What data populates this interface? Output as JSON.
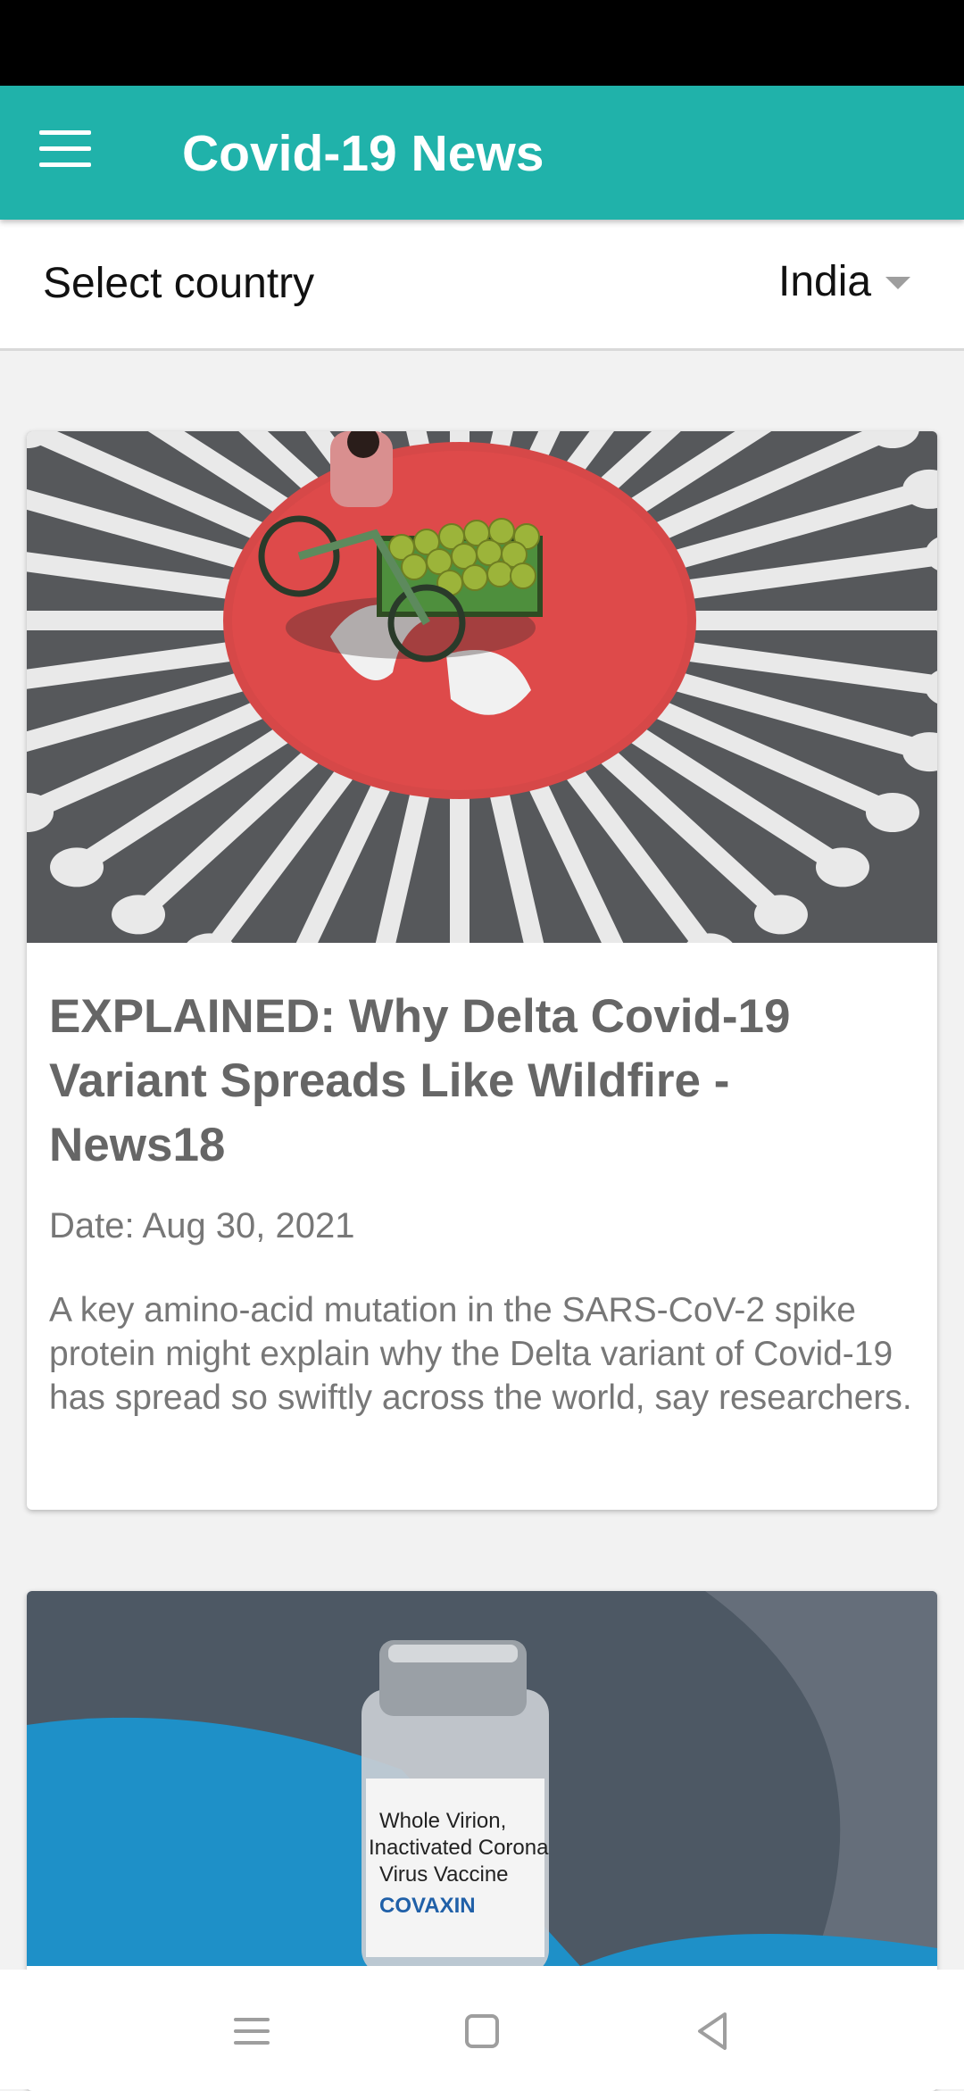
{
  "app_bar": {
    "title": "Covid-19 News",
    "menu_icon": "hamburger-menu-icon",
    "background": "#20b2aa"
  },
  "country_selector": {
    "label": "Select country",
    "selected": "India"
  },
  "articles": [
    {
      "image": "covid-virus-road-painting-with-coconut-cart",
      "title": "EXPLAINED: Why Delta Covid-19 Variant Spreads Like Wildfire - News18",
      "date": "Date: Aug 30, 2021",
      "description": "A key amino-acid mutation in the SARS-CoV-2 spike protein might explain why the Delta variant of Covid-19 has spread so swiftly across the world, say researchers."
    },
    {
      "image": "covaxin-vaccine-vial",
      "vial_lines": [
        "Whole Virion,",
        "Inactivated Corona",
        "Virus Vaccine",
        "COVAXIN"
      ]
    }
  ],
  "nav_bar": {
    "icons": [
      "recents-icon",
      "home-icon",
      "back-icon"
    ]
  }
}
